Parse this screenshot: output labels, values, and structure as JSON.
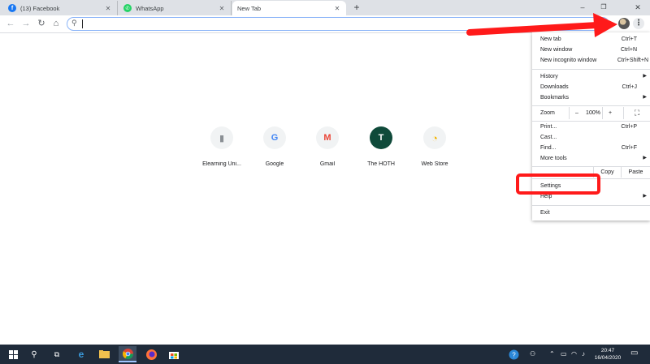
{
  "tabs": [
    {
      "title": "(13) Facebook",
      "icon": "facebook-icon",
      "color": "#1877f2",
      "glyph": "f"
    },
    {
      "title": "WhatsApp",
      "icon": "whatsapp-icon",
      "color": "#25d366",
      "glyph": "✆"
    },
    {
      "title": "New Tab",
      "icon": "",
      "color": "",
      "glyph": ""
    }
  ],
  "omnibox": {
    "value": "",
    "placeholder": ""
  },
  "shortcuts": [
    {
      "label": "Elearning Uni...",
      "glyph": "▮",
      "color": "#8a8f94"
    },
    {
      "label": "Google",
      "glyph": "G",
      "color": "#4285f4"
    },
    {
      "label": "Gmail",
      "glyph": "M",
      "color": "#ea4335"
    },
    {
      "label": "The HOTH",
      "glyph": "T",
      "color": "#ffffff"
    },
    {
      "label": "Web Store",
      "glyph": "◔",
      "color": "#f4b400"
    }
  ],
  "menu": {
    "new_tab": {
      "label": "New tab",
      "shortcut": "Ctrl+T"
    },
    "new_window": {
      "label": "New window",
      "shortcut": "Ctrl+N"
    },
    "new_incognito": {
      "label": "New incognito window",
      "shortcut": "Ctrl+Shift+N"
    },
    "history": {
      "label": "History"
    },
    "downloads": {
      "label": "Downloads",
      "shortcut": "Ctrl+J"
    },
    "bookmarks": {
      "label": "Bookmarks"
    },
    "zoom": {
      "label": "Zoom",
      "minus": "–",
      "value": "100%",
      "plus": "+"
    },
    "print": {
      "label": "Print...",
      "shortcut": "Ctrl+P"
    },
    "cast": {
      "label": "Cast..."
    },
    "find": {
      "label": "Find...",
      "shortcut": "Ctrl+F"
    },
    "more_tools": {
      "label": "More tools"
    },
    "edit": {
      "copy": "Copy",
      "paste": "Paste"
    },
    "settings": {
      "label": "Settings"
    },
    "help": {
      "label": "Help"
    },
    "exit": {
      "label": "Exit"
    }
  },
  "taskbar": {
    "time": "20:47",
    "date": "16/04/2020"
  },
  "colors": {
    "annotation": "#ff1a1a",
    "omnibox_focus": "#8ab4f8"
  }
}
